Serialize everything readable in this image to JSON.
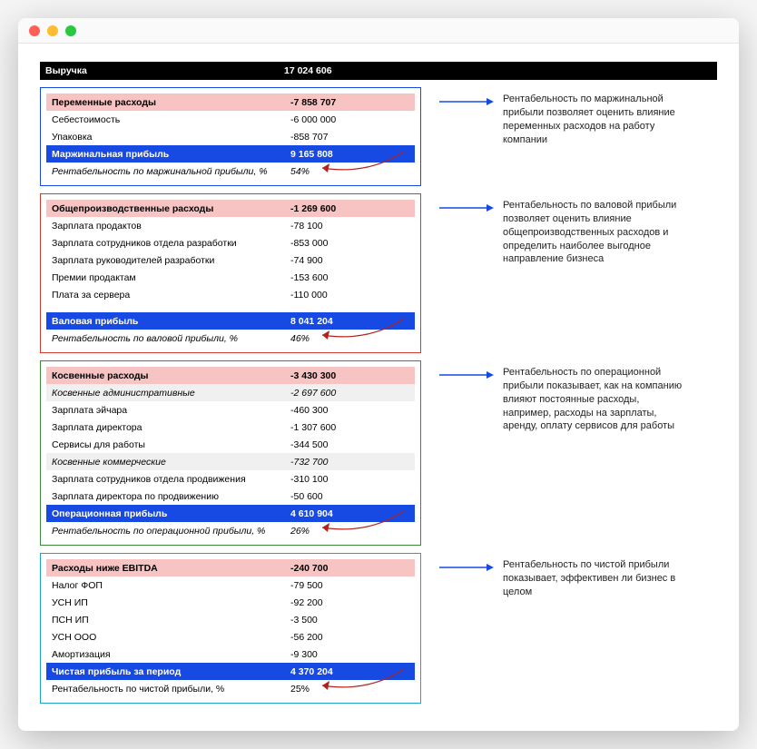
{
  "header": {
    "label": "Выручка",
    "value": "17 024 606"
  },
  "sections": [
    {
      "border": "blue",
      "rows": [
        {
          "type": "pink",
          "label": "Переменные расходы",
          "value": "-7 858 707"
        },
        {
          "type": "plain",
          "label": "Себестоимость",
          "value": "-6 000 000"
        },
        {
          "type": "plain",
          "label": "Упаковка",
          "value": "-858 707"
        },
        {
          "type": "blue",
          "label": "Маржинальная прибыль",
          "value": "9 165 808"
        },
        {
          "type": "italic",
          "label": "Рентабельность по маржинальной прибыли, %",
          "value": "54%"
        }
      ],
      "note": "Рентабельность по маржинальной прибыли позволяет оценить влияние переменных расходов на работу компании"
    },
    {
      "border": "red",
      "rows": [
        {
          "type": "pink",
          "label": "Общепроизводственные расходы",
          "value": "-1 269 600"
        },
        {
          "type": "plain",
          "label": "Зарплата продактов",
          "value": "-78 100"
        },
        {
          "type": "plain",
          "label": "Зарплата сотрудников отдела разработки",
          "value": "-853 000"
        },
        {
          "type": "plain",
          "label": "Зарплата руководителей разработки",
          "value": "-74 900"
        },
        {
          "type": "plain",
          "label": "Премии продактам",
          "value": "-153 600"
        },
        {
          "type": "plain",
          "label": "Плата за сервера",
          "value": "-110 000"
        },
        {
          "type": "spacer"
        },
        {
          "type": "blue",
          "label": "Валовая прибыль",
          "value": "8 041 204"
        },
        {
          "type": "italic",
          "label": "Рентабельность по валовой прибыли, %",
          "value": "46%"
        }
      ],
      "note": "Рентабельность по валовой прибыли позволяет оценить влияние общепроизводственных расходов и определить наиболее выгодное направление бизнеса"
    },
    {
      "border": "green",
      "rows": [
        {
          "type": "pink",
          "label": "Косвенные расходы",
          "value": "-3 430 300"
        },
        {
          "type": "gray-italic",
          "label": "Косвенные административные",
          "value": "-2 697 600"
        },
        {
          "type": "plain",
          "label": "Зарплата эйчара",
          "value": "-460 300"
        },
        {
          "type": "plain",
          "label": "Зарплата директора",
          "value": "-1 307 600"
        },
        {
          "type": "plain",
          "label": "Сервисы для работы",
          "value": "-344 500"
        },
        {
          "type": "gray-italic",
          "label": "Косвенные коммерческие",
          "value": "-732 700"
        },
        {
          "type": "plain",
          "label": "Зарплата сотрудников отдела продвижения",
          "value": "-310 100"
        },
        {
          "type": "plain",
          "label": "Зарплата директора по продвижению",
          "value": "-50 600"
        },
        {
          "type": "blue",
          "label": "Операционная прибыль",
          "value": "4 610 904"
        },
        {
          "type": "italic",
          "label": "Рентабельность по операционной прибыли, %",
          "value": "26%"
        }
      ],
      "note": "Рентабельность по операционной прибыли показывает, как на компанию влияют постоянные расходы, например, расходы на зарплаты, аренду, оплату сервисов для работы"
    },
    {
      "border": "cyan",
      "rows": [
        {
          "type": "pink",
          "label": "Расходы ниже EBITDA",
          "value": "-240 700"
        },
        {
          "type": "plain",
          "label": "Налог ФОП",
          "value": "-79 500"
        },
        {
          "type": "plain",
          "label": "УСН ИП",
          "value": "-92 200"
        },
        {
          "type": "plain",
          "label": "ПСН ИП",
          "value": "-3 500"
        },
        {
          "type": "plain",
          "label": "УСН ООО",
          "value": "-56 200"
        },
        {
          "type": "plain",
          "label": "Амортизация",
          "value": "-9 300"
        },
        {
          "type": "blue",
          "label": "Чистая прибыль за период",
          "value": "4 370 204"
        },
        {
          "type": "plain",
          "label": "Рентабельность по чистой прибыли, %",
          "value": "25%"
        }
      ],
      "note": "Рентабельность по чистой прибыли показывает, эффективен ли бизнес в целом"
    }
  ]
}
